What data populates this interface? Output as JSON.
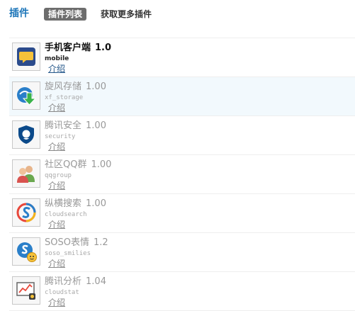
{
  "header": {
    "title": "插件",
    "tab_active": "插件列表",
    "tab_more": "获取更多插件"
  },
  "colors": {
    "accent": "#1a74b8",
    "tab_bg": "#6d6d6d",
    "highlight_row": "#f2f9fd",
    "muted_text": "#999999"
  },
  "plugins": [
    {
      "name": "手机客户端",
      "version": "1.0",
      "id": "mobile",
      "link": "介绍",
      "icon": "mobile-chat-icon",
      "enabled": true
    },
    {
      "name": "旋风存储",
      "version": "1.00",
      "id": "xf_storage",
      "link": "介绍",
      "icon": "storage-download-icon",
      "enabled": false
    },
    {
      "name": "腾讯安全",
      "version": "1.00",
      "id": "security",
      "link": "介绍",
      "icon": "security-shield-icon",
      "enabled": false
    },
    {
      "name": "社区QQ群",
      "version": "1.00",
      "id": "qqgroup",
      "link": "介绍",
      "icon": "qq-group-icon",
      "enabled": false
    },
    {
      "name": "纵横搜索",
      "version": "1.00",
      "id": "cloudsearch",
      "link": "介绍",
      "icon": "cloud-search-icon",
      "enabled": false
    },
    {
      "name": "SOSO表情",
      "version": "1.2",
      "id": "soso_smilies",
      "link": "介绍",
      "icon": "soso-smilies-icon",
      "enabled": false
    },
    {
      "name": "腾讯分析",
      "version": "1.04",
      "id": "cloudstat",
      "link": "介绍",
      "icon": "cloudstat-chart-icon",
      "enabled": false
    }
  ]
}
